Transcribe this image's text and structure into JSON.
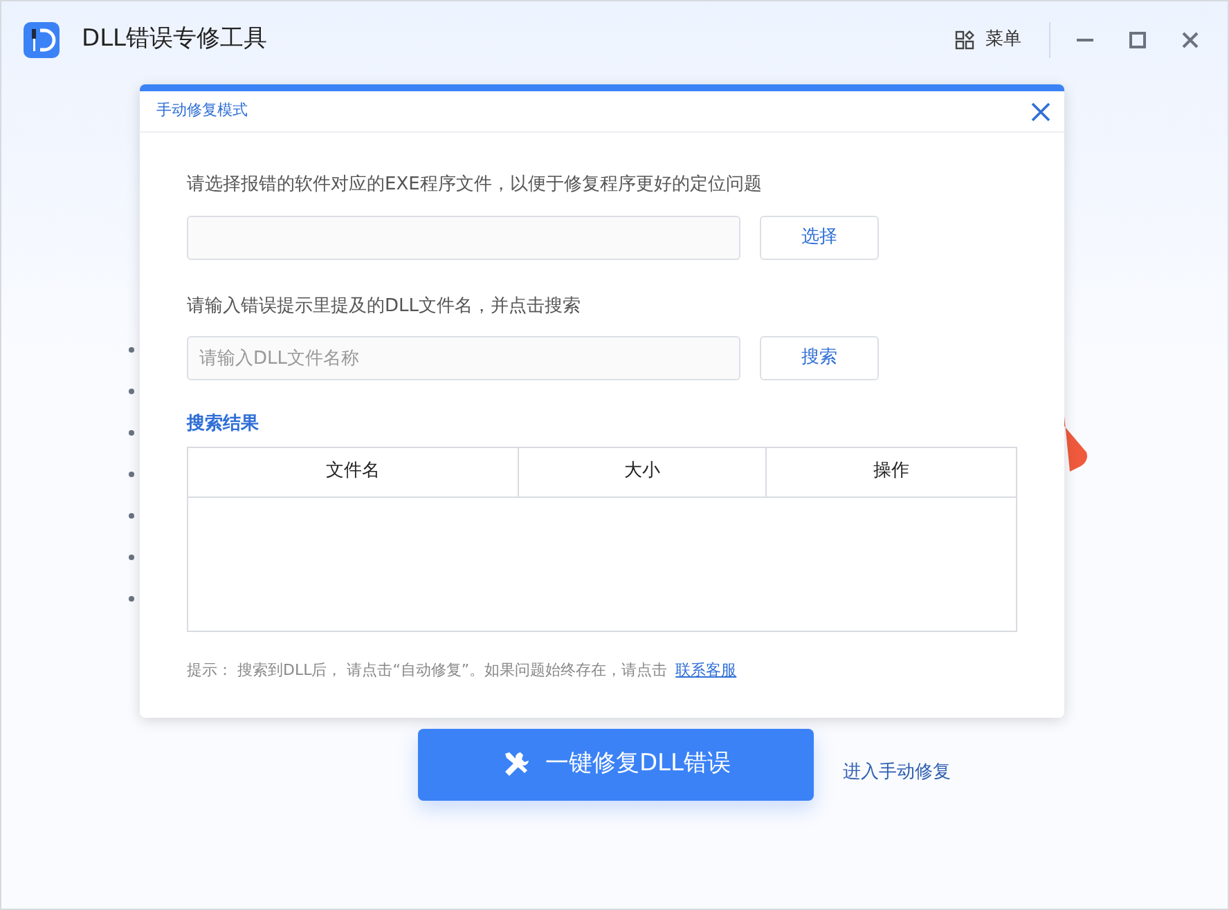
{
  "app": {
    "title": "DLL错误专修工具",
    "menu_label": "菜单"
  },
  "dialog": {
    "title": "手动修复模式",
    "exe_prompt": "请选择报错的软件对应的EXE程序文件，以便于修复程序更好的定位问题",
    "exe_button": "选择",
    "dll_prompt": "请输入错误提示里提及的DLL文件名，并点击搜索",
    "dll_field": {
      "placeholder": "请输入DLL文件名称"
    },
    "dll_button": "搜索",
    "results_title": "搜索结果",
    "table": {
      "columns": [
        "文件名",
        "大小",
        "操作"
      ]
    },
    "hint": "提示： 搜索到DLL后， 请点击“自动修复”。如果问题始终存在，请点击",
    "hint_link": "联系客服"
  },
  "main": {
    "fix_button": "一键修复DLL错误",
    "manual_link": "进入手动修复"
  }
}
